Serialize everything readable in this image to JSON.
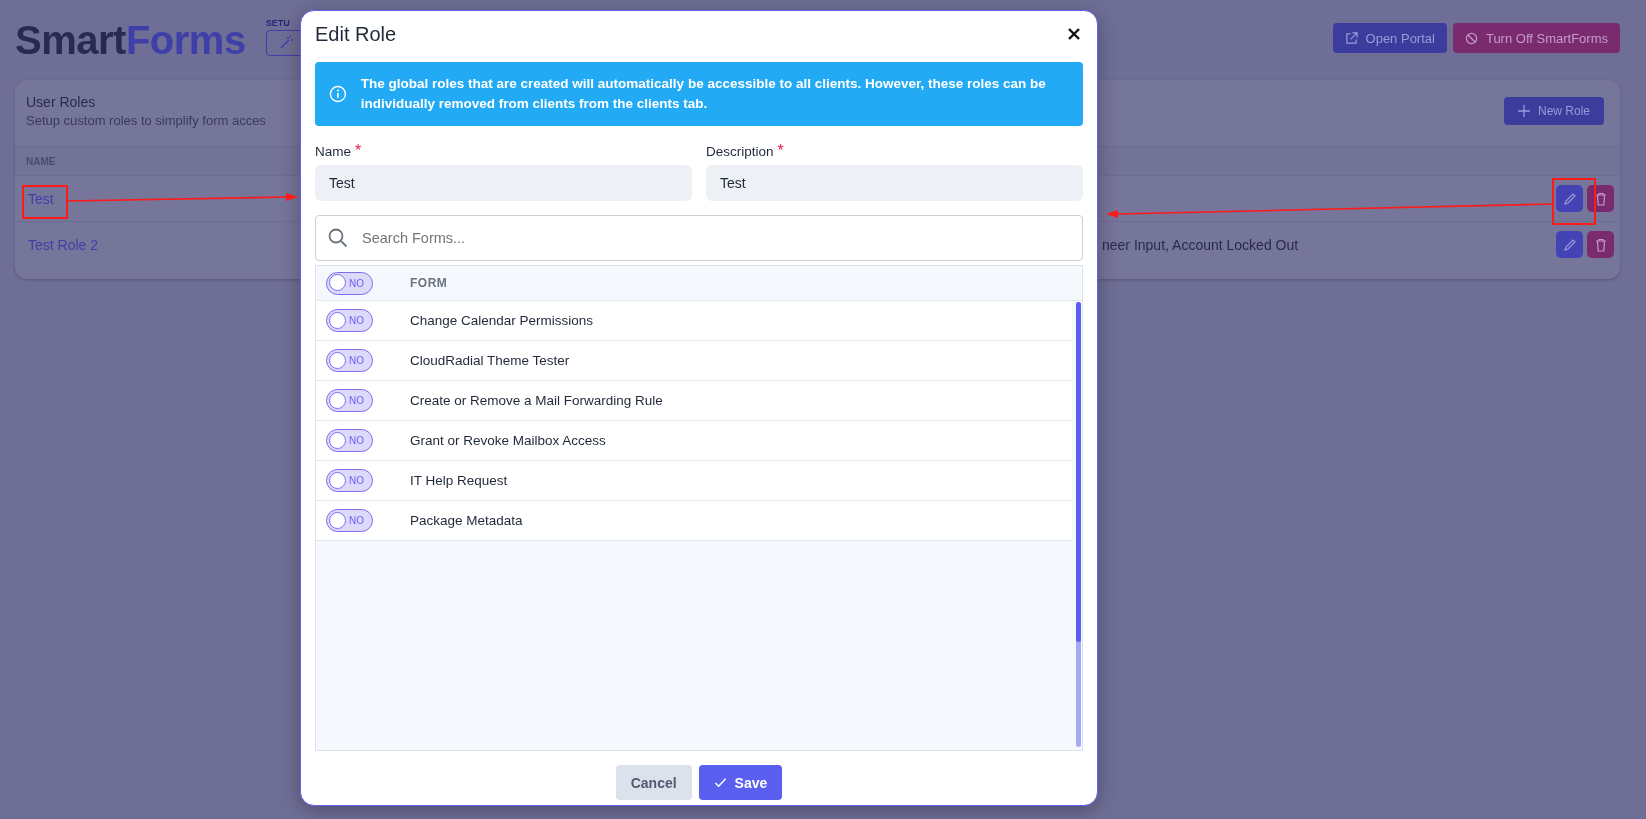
{
  "header": {
    "logo_dark": "Smart",
    "logo_accent": "Forms",
    "setup_label": "SETU",
    "buttons": [
      {
        "label": "Open Portal",
        "kind": "portal"
      },
      {
        "label": "Turn Off SmartForms",
        "kind": "danger"
      }
    ]
  },
  "roles_card": {
    "title": "User Roles",
    "subtitle": "Setup custom roles to simplify form acces",
    "new_button": "New Role",
    "columns": [
      "NAME"
    ],
    "rows": [
      {
        "name": "Test",
        "forms": ""
      },
      {
        "name": "Test Role 2",
        "forms": "neer Input, Account Locked Out"
      }
    ]
  },
  "modal": {
    "title": "Edit Role",
    "info": "The global roles that are created will automatically be accessible to all clients. However, these roles can be individually removed from clients from the clients tab.",
    "fields": [
      {
        "label": "Name",
        "required_mark": "*",
        "value": "Test"
      },
      {
        "label": "Description",
        "required_mark": "*",
        "value": "Test"
      }
    ],
    "search": {
      "placeholder": "Search Forms..."
    },
    "table_header": {
      "toggle": {
        "on": false,
        "label": "NO"
      },
      "column": "FORM"
    },
    "forms": [
      {
        "name": "Change Calendar Permissions",
        "on": false,
        "toggle_label": "NO"
      },
      {
        "name": "CloudRadial Theme Tester",
        "on": false,
        "toggle_label": "NO"
      },
      {
        "name": "Create or Remove a Mail Forwarding Rule",
        "on": false,
        "toggle_label": "NO"
      },
      {
        "name": "Grant or Revoke Mailbox Access",
        "on": false,
        "toggle_label": "NO"
      },
      {
        "name": "IT Help Request",
        "on": false,
        "toggle_label": "NO"
      },
      {
        "name": "Package Metadata",
        "on": false,
        "toggle_label": "NO"
      }
    ],
    "buttons": [
      {
        "label": "Cancel",
        "kind": "secondary"
      },
      {
        "label": "Save",
        "kind": "primary"
      }
    ]
  }
}
